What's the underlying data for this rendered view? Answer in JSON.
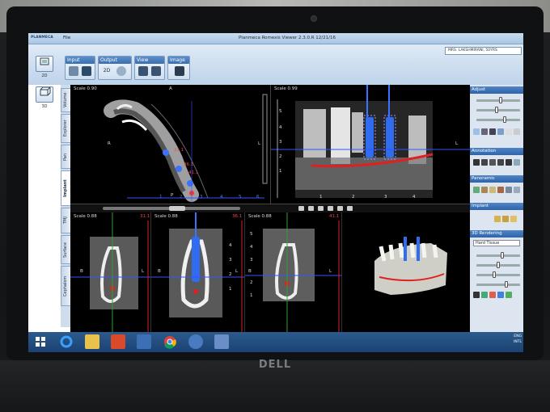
{
  "device": {
    "brand": "DELL"
  },
  "app": {
    "logo": "PLANMECA",
    "file_menu": "File",
    "title": "Planmeca Romexis Viewer 2.3.0.R   12/21/16",
    "patient": "MRS. LAKSHMIRANI, 50YRS"
  },
  "toolbar": {
    "groups": [
      {
        "label": "Input"
      },
      {
        "label": "Output"
      },
      {
        "label": "View"
      },
      {
        "label": "Image"
      }
    ],
    "output_2d": "2D"
  },
  "modes": {
    "mode_2d": "2D",
    "mode_3d": "3D"
  },
  "left_tabs": [
    "Volume",
    "Explorer",
    "Pan",
    "Implant",
    "TMJ",
    "Surface",
    "Cephalom"
  ],
  "views": {
    "axial": {
      "scale": "Scale 0.90",
      "orientation_top": "A",
      "orientation_left": "R",
      "orientation_right": "L",
      "orientation_bottom": "P",
      "labels": [
        "31.1",
        "36.1",
        "41.1"
      ],
      "ticks": [
        "1",
        "2",
        "3",
        "4",
        "5",
        "6"
      ]
    },
    "panoramic": {
      "scale": "Scale 0.99",
      "orientation_right": "L",
      "ticks_y": [
        "5",
        "4",
        "3",
        "2",
        "1"
      ],
      "ticks_x": [
        "1",
        "2",
        "3",
        "4"
      ]
    },
    "cross1": {
      "scale": "Scale 0.88",
      "label": "31.1",
      "side_left": "B",
      "side_right": "L"
    },
    "cross2": {
      "scale": "Scale 0.88",
      "label": "36.1",
      "side_left": "B",
      "side_right": "L",
      "ticks": [
        "4",
        "3",
        "2",
        "1"
      ]
    },
    "cross3": {
      "scale": "Scale 0.88",
      "label": "41.1",
      "side_left": "B",
      "side_right": "L",
      "ticks": [
        "5",
        "4",
        "3",
        "2",
        "1"
      ]
    },
    "render3d": {}
  },
  "right_panel": {
    "adjust": "Adjust",
    "annotation": "Annotation",
    "panoramic": "Panoramic",
    "implant": "Implant",
    "rendering": "3D Rendering",
    "rendering_preset": "Hard Tissue",
    "adjust_levels": [
      0.55,
      0.45,
      0.65
    ],
    "render_levels": [
      0.6,
      0.5,
      0.4,
      0.7
    ]
  },
  "taskbar": {
    "lang": "ENG",
    "region": "INTL"
  },
  "colors": {
    "ribbon_blue": "#3b6eae",
    "implant_blue": "#2f6cf0",
    "nerve_red": "#e02020",
    "taskbar": "#1b4272"
  }
}
